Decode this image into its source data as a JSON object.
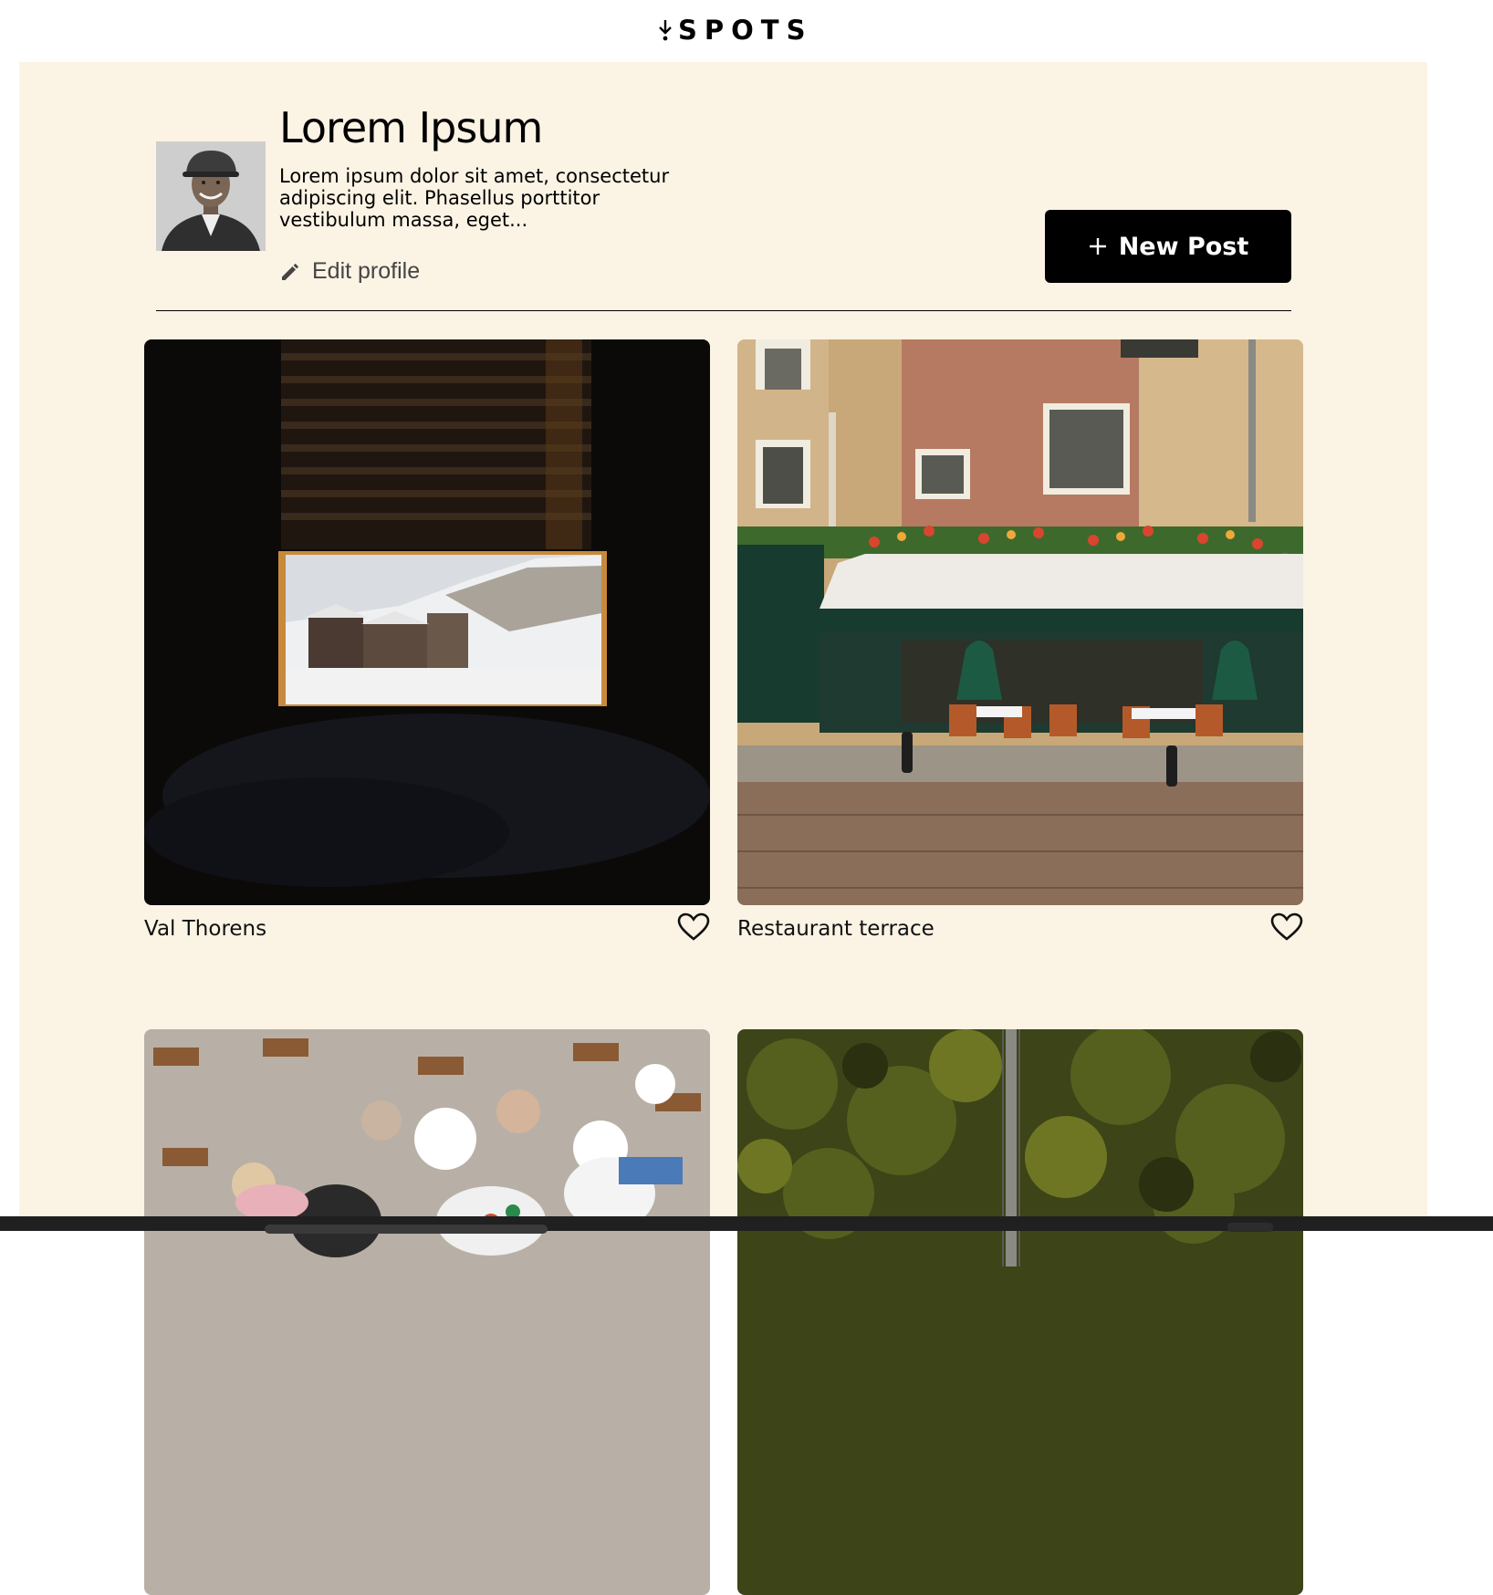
{
  "app": {
    "logo_text": "SPOTS",
    "logo_icon": "arrow-down-logo-icon"
  },
  "profile": {
    "name": "Lorem Ipsum",
    "bio": "Lorem ipsum dolor sit amet, consectetur adipiscing elit. Phasellus porttitor vestibulum massa, eget...",
    "edit_label": "Edit profile",
    "edit_icon": "pencil-icon",
    "avatar_icon": "avatar"
  },
  "actions": {
    "new_post_label": "New Post",
    "new_post_icon": "plus-icon"
  },
  "cards": [
    {
      "title": "Val Thorens",
      "liked": false,
      "like_icon": "heart-outline-icon"
    },
    {
      "title": "Restaurant terrace",
      "liked": false,
      "like_icon": "heart-outline-icon"
    },
    {
      "title": "",
      "liked": false
    },
    {
      "title": "",
      "liked": false
    }
  ],
  "colors": {
    "page_bg": "#fbf3e4",
    "button_bg": "#000000",
    "button_text": "#ffffff"
  }
}
